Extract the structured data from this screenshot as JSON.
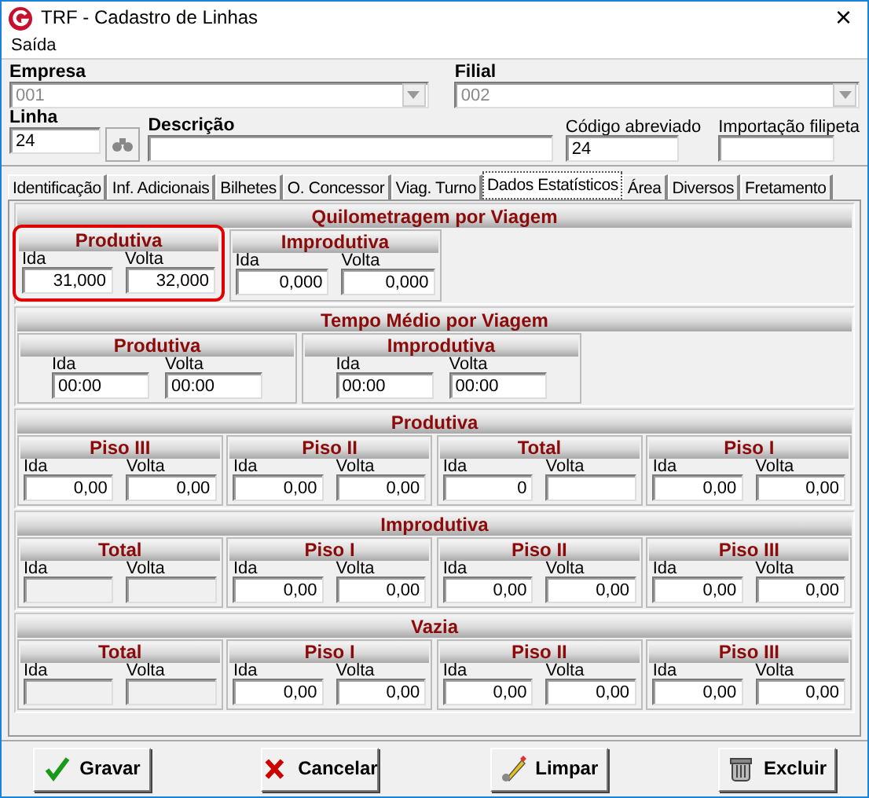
{
  "window": {
    "title": "TRF - Cadastro de Linhas",
    "close": "×"
  },
  "menu": [
    "Saída"
  ],
  "header": {
    "empresa": {
      "label": "Empresa",
      "value": "001"
    },
    "filial": {
      "label": "Filial",
      "value": "002"
    },
    "linha": {
      "label": "Linha",
      "value": "24"
    },
    "descricao": {
      "label": "Descrição"
    },
    "codigo": {
      "label": "Código abreviado",
      "value": "24"
    },
    "importacao": {
      "label": "Importação filipeta"
    }
  },
  "tabs": [
    {
      "label": "Identificação",
      "selected": false
    },
    {
      "label": "Inf. Adicionais",
      "selected": false
    },
    {
      "label": "Bilhetes",
      "selected": false
    },
    {
      "label": "O. Concessor",
      "selected": false
    },
    {
      "label": "Viag. Turno",
      "selected": false
    },
    {
      "label": "Dados Estatísticos",
      "selected": true
    },
    {
      "label": "Área",
      "selected": false
    },
    {
      "label": "Diversos",
      "selected": false
    },
    {
      "label": "Fretamento",
      "selected": false
    }
  ],
  "sections": [
    {
      "title": "Quilometragem por Viagem",
      "kind": "distance",
      "groups": [
        {
          "title": "Produtiva",
          "highlighted": true,
          "fields": [
            {
              "label": "Ida",
              "value": "31,000",
              "disabled": false
            },
            {
              "label": "Volta",
              "value": "32,000",
              "disabled": false
            }
          ]
        },
        {
          "title": "Improdutiva",
          "highlighted": false,
          "fields": [
            {
              "label": "Ida",
              "value": "0,000",
              "disabled": false
            },
            {
              "label": "Volta",
              "value": "0,000",
              "disabled": false
            }
          ]
        }
      ]
    },
    {
      "title": "Tempo Médio por Viagem",
      "kind": "time",
      "groups": [
        {
          "title": "Produtiva",
          "highlighted": false,
          "fields": [
            {
              "label": "Ida",
              "value": "00:00",
              "disabled": false
            },
            {
              "label": "Volta",
              "value": "00:00",
              "disabled": false
            }
          ]
        },
        {
          "title": "Improdutiva",
          "highlighted": false,
          "fields": [
            {
              "label": "Ida",
              "value": "00:00",
              "disabled": false
            },
            {
              "label": "Volta",
              "value": "00:00",
              "disabled": false
            }
          ]
        }
      ]
    },
    {
      "title": "Produtiva",
      "kind": "floors",
      "groups": [
        {
          "title": "Piso III",
          "highlighted": false,
          "fields": [
            {
              "label": "Ida",
              "value": "0,00",
              "disabled": false
            },
            {
              "label": "Volta",
              "value": "0,00",
              "disabled": false
            }
          ]
        },
        {
          "title": "Piso II",
          "highlighted": false,
          "fields": [
            {
              "label": "Ida",
              "value": "0,00",
              "disabled": false
            },
            {
              "label": "Volta",
              "value": "0,00",
              "disabled": false
            }
          ]
        },
        {
          "title": "Total",
          "highlighted": false,
          "fields": [
            {
              "label": "Ida",
              "value": "0",
              "disabled": false
            },
            {
              "label": "Volta",
              "disabled": false
            }
          ]
        },
        {
          "title": "Piso I",
          "highlighted": false,
          "fields": [
            {
              "label": "Ida",
              "value": "0,00",
              "disabled": false
            },
            {
              "label": "Volta",
              "value": "0,00",
              "disabled": false
            }
          ]
        }
      ]
    },
    {
      "title": "Improdutiva",
      "kind": "floors",
      "groups": [
        {
          "title": "Total",
          "highlighted": false,
          "fields": [
            {
              "label": "Ida",
              "disabled": true
            },
            {
              "label": "Volta",
              "disabled": true
            }
          ]
        },
        {
          "title": "Piso I",
          "highlighted": false,
          "fields": [
            {
              "label": "Ida",
              "value": "0,00",
              "disabled": false
            },
            {
              "label": "Volta",
              "value": "0,00",
              "disabled": false
            }
          ]
        },
        {
          "title": "Piso II",
          "highlighted": false,
          "fields": [
            {
              "label": "Ida",
              "value": "0,00",
              "disabled": false
            },
            {
              "label": "Volta",
              "value": "0,00",
              "disabled": false
            }
          ]
        },
        {
          "title": "Piso III",
          "highlighted": false,
          "fields": [
            {
              "label": "Ida",
              "value": "0,00",
              "disabled": false
            },
            {
              "label": "Volta",
              "value": "0,00",
              "disabled": false
            }
          ]
        }
      ]
    },
    {
      "title": "Vazia",
      "kind": "floors",
      "groups": [
        {
          "title": "Total",
          "highlighted": false,
          "fields": [
            {
              "label": "Ida",
              "disabled": true
            },
            {
              "label": "Volta",
              "disabled": true
            }
          ]
        },
        {
          "title": "Piso I",
          "highlighted": false,
          "fields": [
            {
              "label": "Ida",
              "value": "0,00",
              "disabled": false
            },
            {
              "label": "Volta",
              "value": "0,00",
              "disabled": false
            }
          ]
        },
        {
          "title": "Piso II",
          "highlighted": false,
          "fields": [
            {
              "label": "Ida",
              "value": "0,00",
              "disabled": false
            },
            {
              "label": "Volta",
              "value": "0,00",
              "disabled": false
            }
          ]
        },
        {
          "title": "Piso III",
          "highlighted": false,
          "fields": [
            {
              "label": "Ida",
              "value": "0,00",
              "disabled": false
            },
            {
              "label": "Volta",
              "value": "0,00",
              "disabled": false
            }
          ]
        }
      ]
    }
  ],
  "buttons": [
    {
      "label": "Gravar",
      "kind": "save"
    },
    {
      "label": "Cancelar",
      "kind": "cancel"
    },
    {
      "label": "Limpar",
      "kind": "clear"
    },
    {
      "label": "Excluir",
      "kind": "delete"
    }
  ]
}
